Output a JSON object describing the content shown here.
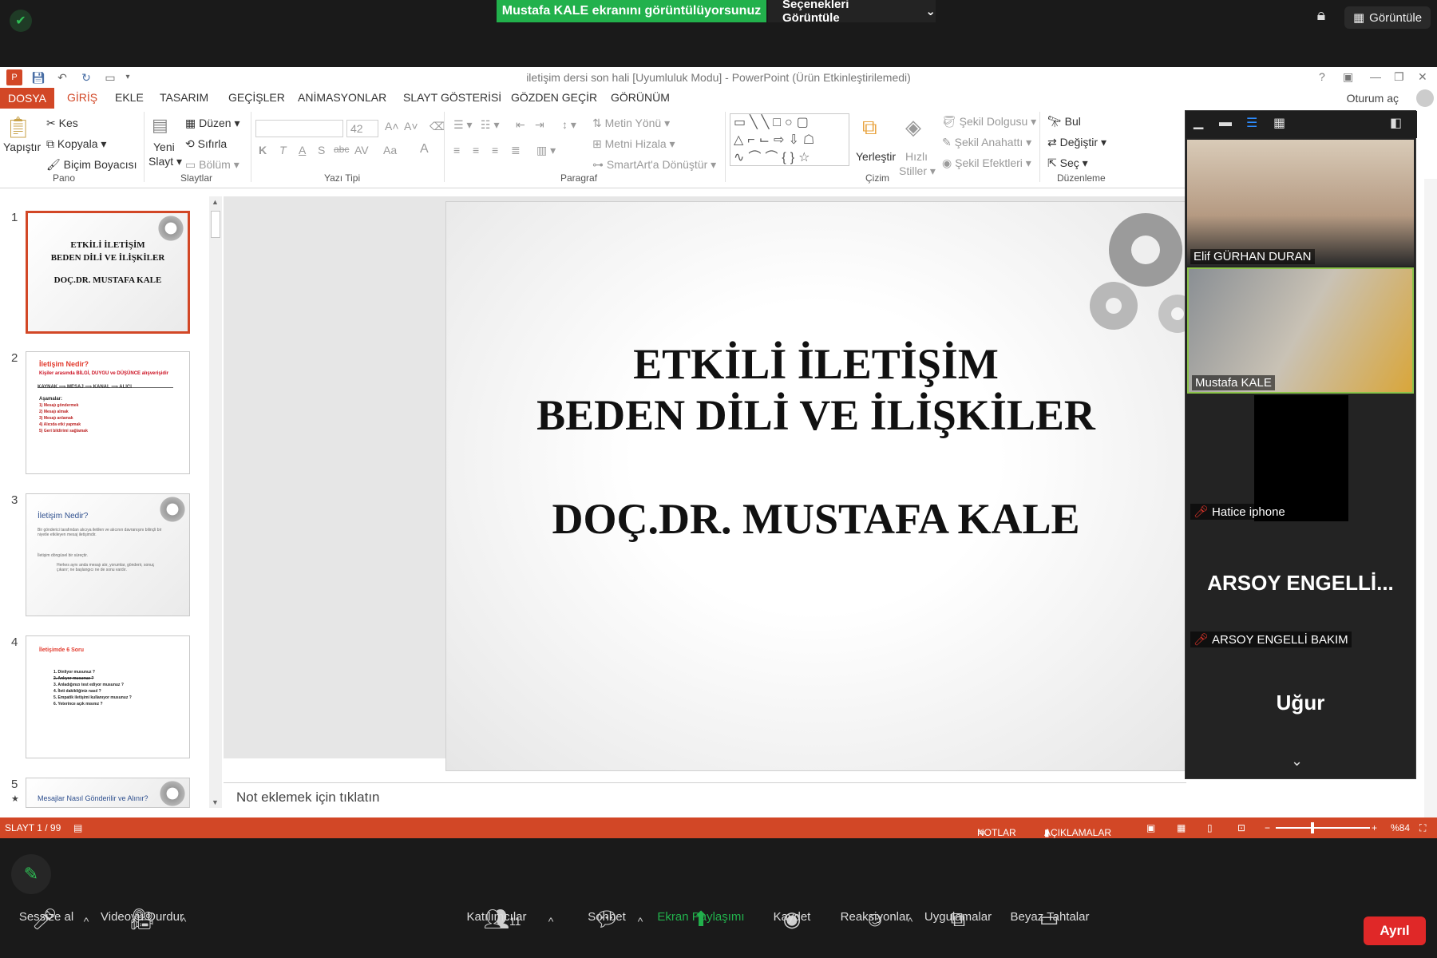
{
  "zoom_top": {
    "share_banner": "Mustafa KALE ekranını görüntülüyorsunuz",
    "view_options": "Seçenekleri Görüntüle",
    "view_button": "Görüntüle"
  },
  "ppt": {
    "window_title": "iletişim dersi son hali [Uyumluluk Modu] - PowerPoint (Ürün Etkinleştirilemedi)",
    "login": "Oturum aç",
    "tabs": [
      "DOSYA",
      "GİRİŞ",
      "EKLE",
      "TASARIM",
      "GEÇİŞLER",
      "ANİMASYONLAR",
      "SLAYT GÖSTERİSİ",
      "GÖZDEN GEÇİR",
      "GÖRÜNÜM"
    ],
    "ribbon": {
      "pano": {
        "label": "Pano",
        "paste": "Yapıştır",
        "cut": "Kes",
        "copy": "Kopyala",
        "format_painter": "Biçim Boyacısı"
      },
      "slaytlar": {
        "label": "Slaytlar",
        "new_slide_1": "Yeni",
        "new_slide_2": "Slayt",
        "layout": "Düzen",
        "reset": "Sıfırla",
        "section": "Bölüm"
      },
      "yazi_tipi": {
        "label": "Yazı Tipi",
        "font_size": "42",
        "bold": "K",
        "italic": "T",
        "underline": "A",
        "shadow": "S",
        "strike": "abc",
        "spacing": "AV",
        "case": "Aa",
        "color": "A"
      },
      "paragraf": {
        "label": "Paragraf",
        "text_direction": "Metin Yönü",
        "align_text": "Metni Hizala",
        "smartart": "SmartArt'a Dönüştür"
      },
      "cizim": {
        "label": "Çizim",
        "arrange": "Yerleştir",
        "quick_styles_1": "Hızlı",
        "quick_styles_2": "Stiller",
        "shape_fill": "Şekil Dolgusu",
        "shape_outline": "Şekil Anahattı",
        "shape_effects": "Şekil Efektleri"
      },
      "duzenleme": {
        "label": "Düzenleme",
        "find": "Bul",
        "replace": "Değiştir",
        "select": "Seç"
      }
    },
    "thumbnails": [
      {
        "num": "1",
        "line1": "ETKİLİ İLETİŞİM",
        "line2": "BEDEN DİLİ VE İLİŞKİLER",
        "line3": "DOÇ.DR. MUSTAFA KALE"
      },
      {
        "num": "2",
        "title": "İletişim Nedir?",
        "sub": "Kişiler arasında BİLGİ, DUYGU ve DÜŞÜNCE alışverişidir",
        "flow": "KAYNAK ⟹ MESAJ ⟹ KANAL ⟹ ALICI",
        "stages_title": "Aşamalar:",
        "items": [
          "1) Mesajı göndermek",
          "2) Mesajı almak",
          "3) Mesajı anlamak",
          "4) Alıcıda etki yapmak",
          "5) Geri bildirimi sağlamak"
        ]
      },
      {
        "num": "3",
        "title": "İletişim Nedir?",
        "body1": "Bir gönderici tarafından alıcıya iletilen ve alıcının davranışını bilinçli bir niyetle etkileyen mesaj iletişimdir.",
        "body2": "İletişim döngüsel bir süreçtir.",
        "body3": "Herkes aynı anda mesajı alır, yorumlar, gönderir, sonuç çıkarır; ne başlangıcı ne de sonu vardır."
      },
      {
        "num": "4",
        "title": "İletişimde 6 Soru",
        "items": [
          "1. Dinliyor musunuz ?",
          "2. Anlıyor musunuz ?",
          "3. Anladığınızı test ediyor musunuz ?",
          "4. İleti dakikliğiniz nasıl ?",
          "5. Empatik iletişimi kullanıyor musunuz ?",
          "6. Yeterince açık mısınız ?"
        ]
      },
      {
        "num": "5",
        "title": "Mesajlar Nasıl Gönderilir ve Alınır?"
      }
    ],
    "slide": {
      "line1": "ETKİLİ  İLETİŞİM",
      "line2": "BEDEN DİLİ VE İLİŞKİLER",
      "line3": "DOÇ.DR. MUSTAFA KALE"
    },
    "notes_placeholder": "Not eklemek için tıklatın",
    "status": {
      "slide_counter": "SLAYT 1 / 99",
      "notes": "NOTLAR",
      "comments": "AÇIKLAMALAR",
      "zoom": "%84"
    }
  },
  "participants": [
    {
      "name": "Elif GÜRHAN DURAN",
      "muted": false
    },
    {
      "name": "Mustafa KALE",
      "muted": false
    },
    {
      "name": "Hatice iphone",
      "muted": true
    },
    {
      "name": "ARSOY ENGELLİ BAKIM",
      "display": "ARSOY  ENGELLİ...",
      "muted": true
    },
    {
      "name": "Uğur",
      "display": "Uğur"
    }
  ],
  "zoom_bottom": {
    "mute": "Sessize al",
    "stop_video": "Videoyu Durdur",
    "participants": "Katılımcılar",
    "participant_count": "11",
    "chat": "Sohbet",
    "share": "Ekran Paylaşımı",
    "record": "Kaydet",
    "reactions": "Reaksiyonlar",
    "apps": "Uygulamalar",
    "whiteboards": "Beyaz Tahtalar",
    "leave": "Ayrıl"
  },
  "colors": {
    "ppt_accent": "#d24726",
    "zoom_green": "#22b14c",
    "leave_red": "#e02828"
  }
}
